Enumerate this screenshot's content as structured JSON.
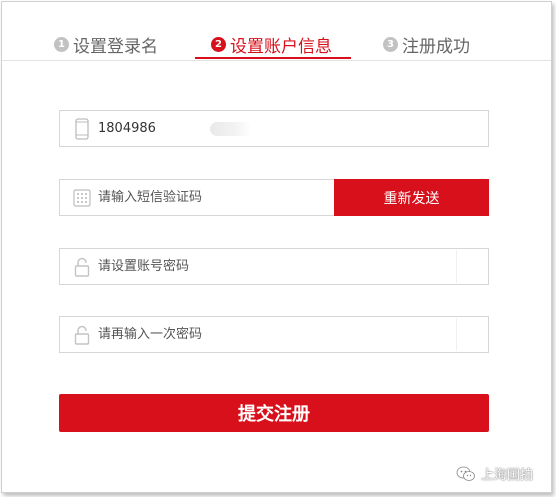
{
  "tabs": [
    {
      "number": "1",
      "label": "设置登录名",
      "active": false
    },
    {
      "number": "2",
      "label": "设置账户信息",
      "active": true
    },
    {
      "number": "3",
      "label": "注册成功",
      "active": false
    }
  ],
  "form": {
    "phone_value": "1804986",
    "code_placeholder": "请输入短信验证码",
    "resend_label": "重新发送",
    "password_placeholder": "请设置账号密码",
    "confirm_placeholder": "请再输入一次密码",
    "submit_label": "提交注册"
  },
  "icons": {
    "phone": "phone-icon",
    "code": "keypad-icon",
    "password": "lock-icon",
    "confirm": "lock-icon",
    "watermark": "wechat-icon"
  },
  "colors": {
    "accent": "#d7101b",
    "inactive_tab": "#666666",
    "border": "#d6d6d6"
  },
  "watermark": {
    "text": "上海国拍"
  }
}
